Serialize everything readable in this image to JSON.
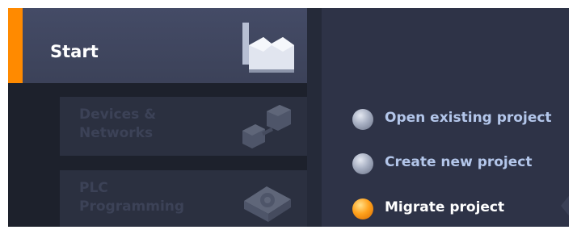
{
  "nav": {
    "start_label": "Start",
    "tiles": [
      {
        "label": "Devices &\nNetworks",
        "icon": "devices-networks-icon"
      },
      {
        "label": "PLC\nProgramming",
        "icon": "plc-programming-icon"
      }
    ],
    "start_icon": "factory-icon"
  },
  "actions": [
    {
      "label": "Open existing project",
      "icon": "gray-bullet-icon"
    },
    {
      "label": "Create new project",
      "icon": "gray-bullet-icon"
    },
    {
      "label": "Migrate project",
      "icon": "orange-bullet-icon"
    }
  ],
  "colors": {
    "accent": "#ff8a00",
    "background": "#2e3347",
    "text_light": "#b3c6ea"
  }
}
